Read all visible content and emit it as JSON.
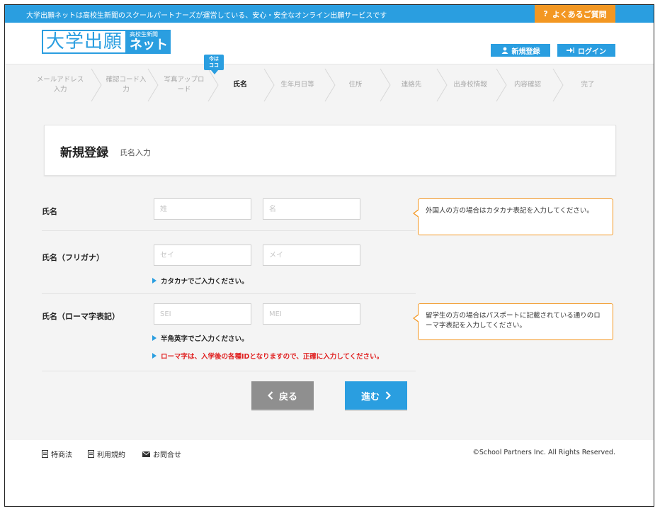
{
  "topbar": {
    "notice": "大学出願ネットは高校生新聞のスクールパートナーズが運営している、安心・安全なオンライン出願サービスです",
    "faq_label": "よくあるご質問",
    "faq_icon": "?"
  },
  "header": {
    "logo_main": "大学出願",
    "logo_sub": "高校生新聞",
    "logo_net": "ネット",
    "register_label": "新規登録",
    "login_label": "ログイン"
  },
  "steps": {
    "here_badge_line1": "今は",
    "here_badge_line2": "ココ",
    "items": [
      {
        "line1": "メールアドレス",
        "line2": "入力"
      },
      {
        "line1": "確認コード入",
        "line2": "力"
      },
      {
        "line1": "写真アップロ",
        "line2": "ード"
      },
      {
        "line1": "氏名",
        "line2": ""
      },
      {
        "line1": "生年月日等",
        "line2": ""
      },
      {
        "line1": "住所",
        "line2": ""
      },
      {
        "line1": "連絡先",
        "line2": ""
      },
      {
        "line1": "出身校情報",
        "line2": ""
      },
      {
        "line1": "内容確認",
        "line2": ""
      },
      {
        "line1": "完了",
        "line2": ""
      }
    ]
  },
  "title": {
    "main": "新規登録",
    "sub": "氏名入力"
  },
  "form": {
    "name": {
      "label": "氏名",
      "last_placeholder": "姓",
      "first_placeholder": "名",
      "note": "外国人の方の場合はカタカナ表記を入力してください。"
    },
    "kana": {
      "label": "氏名（フリガナ）",
      "last_placeholder": "セイ",
      "first_placeholder": "メイ",
      "hint": "カタカナでご入力ください。"
    },
    "roman": {
      "label": "氏名（ローマ字表記）",
      "last_placeholder": "SEI",
      "first_placeholder": "MEI",
      "hint": "半角英字でご入力ください。",
      "warning": "ローマ字は、入学後の各種IDとなりますので、正確に入力してください。",
      "note": "留学生の方の場合はパスポートに記載されている通りのローマ字表記を入力してください。"
    }
  },
  "nav": {
    "back_label": "戻る",
    "next_label": "進む"
  },
  "footer": {
    "links": [
      "特商法",
      "利用規約",
      "お問合せ"
    ],
    "copyright": "©School Partners Inc. All Rights Reserved."
  },
  "colors": {
    "brand_blue": "#2a9ee0",
    "accent_orange": "#f39722",
    "warning_red": "#e02020",
    "back_gray": "#8f8f8f"
  }
}
